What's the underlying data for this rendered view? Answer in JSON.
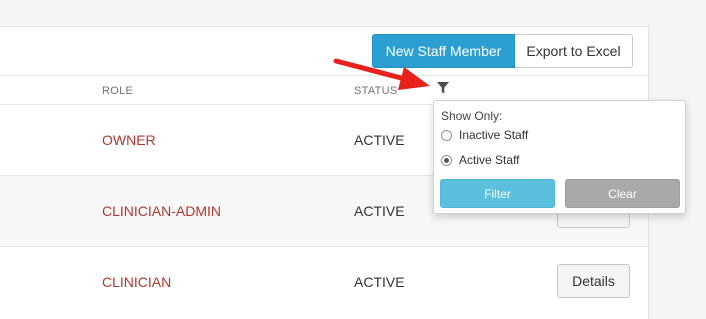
{
  "toolbar": {
    "new_staff_label": "New Staff Member",
    "export_label": "Export to Excel"
  },
  "table": {
    "headers": {
      "role": "ROLE",
      "status": "STATUS"
    },
    "rows": [
      {
        "role": "OWNER",
        "status": "ACTIVE",
        "details": ""
      },
      {
        "role": "CLINICIAN-ADMIN",
        "status": "ACTIVE",
        "details": ""
      },
      {
        "role": "CLINICIAN",
        "status": "ACTIVE",
        "details": "Details"
      }
    ]
  },
  "filter_menu": {
    "title": "Show Only:",
    "options": [
      {
        "label": "Inactive Staff",
        "checked": false
      },
      {
        "label": "Active Staff",
        "checked": true
      }
    ],
    "filter_label": "Filter",
    "clear_label": "Clear"
  },
  "colors": {
    "primary": "#2c9fd2",
    "role_text": "#b03a30",
    "filter_button": "#5bc0de",
    "clear_button": "#a7a9ab",
    "annotation_arrow": "#e8211c"
  },
  "icons": {
    "filter": "funnel-icon",
    "annotation": "red-arrow"
  }
}
